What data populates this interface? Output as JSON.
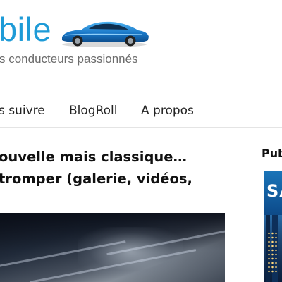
{
  "header": {
    "brand_title": "bile",
    "tagline": "s conducteurs passionnés",
    "logo_icon": "blue-sports-car",
    "accent_color": "#1e9bd7"
  },
  "nav": {
    "items": [
      {
        "label": "s suivre"
      },
      {
        "label": "BlogRoll"
      },
      {
        "label": "A propos"
      }
    ]
  },
  "article": {
    "title_line1": "ouvelle mais classique…",
    "title_line2": "tromper (galerie, vidéos,"
  },
  "sidebar": {
    "title": "Pub",
    "ad_text": "SA"
  }
}
